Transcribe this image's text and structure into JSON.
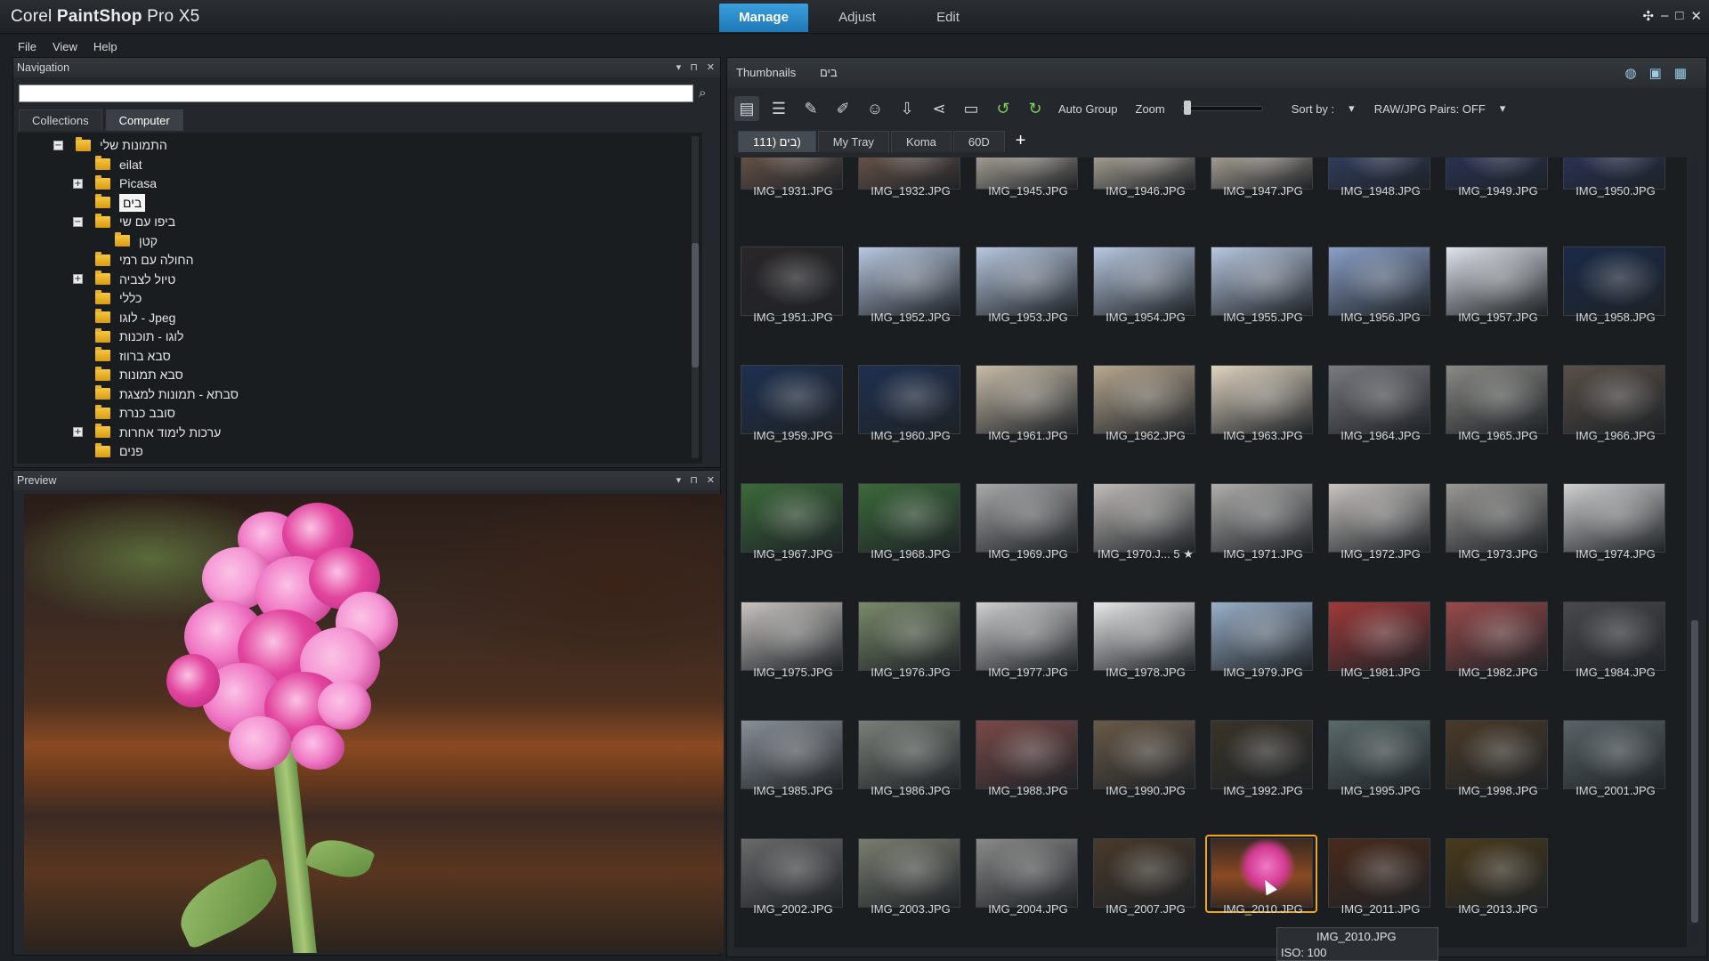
{
  "app": {
    "title_brand": "Corel",
    "title_product": "PaintShop",
    "title_version": "Pro X5",
    "mode_tabs": [
      "Manage",
      "Adjust",
      "Edit"
    ],
    "active_mode": "Manage",
    "window_controls": [
      "✣",
      "–",
      "□",
      "✕"
    ]
  },
  "menu": {
    "items": [
      "File",
      "View",
      "Help"
    ]
  },
  "navigation": {
    "title": "Navigation",
    "search_value": "",
    "tabs": [
      "Collections",
      "Computer"
    ],
    "active_tab": "Computer",
    "tree": [
      {
        "label": "התמונות שלי",
        "indent": 0,
        "expander": "−"
      },
      {
        "label": "eilat",
        "indent": 1,
        "expander": ""
      },
      {
        "label": "Picasa",
        "indent": 1,
        "expander": "+"
      },
      {
        "label": "בים",
        "indent": 1,
        "expander": "",
        "selected": true
      },
      {
        "label": "ביפו עם שי",
        "indent": 1,
        "expander": "−"
      },
      {
        "label": "קטן",
        "indent": 2,
        "expander": ""
      },
      {
        "label": "החולה עם רמי",
        "indent": 1,
        "expander": ""
      },
      {
        "label": "טיול לצביה",
        "indent": 1,
        "expander": "+"
      },
      {
        "label": "כללי",
        "indent": 1,
        "expander": ""
      },
      {
        "label": "לוגו - Jpeg",
        "indent": 1,
        "expander": ""
      },
      {
        "label": "לוגו - תוכנות",
        "indent": 1,
        "expander": ""
      },
      {
        "label": "סבא ברווז",
        "indent": 1,
        "expander": ""
      },
      {
        "label": "סבא תמונות",
        "indent": 1,
        "expander": ""
      },
      {
        "label": "סבתא - תמונות למצגת",
        "indent": 1,
        "expander": ""
      },
      {
        "label": "סובב כנרת",
        "indent": 1,
        "expander": ""
      },
      {
        "label": "ערכות לימוד אחרות",
        "indent": 1,
        "expander": "+"
      },
      {
        "label": "פנים",
        "indent": 1,
        "expander": ""
      }
    ]
  },
  "preview": {
    "title": "Preview"
  },
  "thumbnails": {
    "title": "Thumbnails",
    "folder": "בים",
    "toolbar": {
      "auto_group": "Auto Group",
      "zoom_label": "Zoom",
      "sort_by": "Sort by :",
      "raw_pairs": "RAW/JPG Pairs: OFF"
    },
    "trays": [
      "111) בים)",
      "My Tray",
      "Koma",
      "60D"
    ],
    "active_tray": "111) בים)",
    "add_tray": "+",
    "rows": [
      [
        "IMG_1931.JPG",
        "IMG_1932.JPG",
        "IMG_1945.JPG",
        "IMG_1946.JPG",
        "IMG_1947.JPG",
        "IMG_1948.JPG",
        "IMG_1949.JPG",
        "IMG_1950.JPG"
      ],
      [
        "IMG_1951.JPG",
        "IMG_1952.JPG",
        "IMG_1953.JPG",
        "IMG_1954.JPG",
        "IMG_1955.JPG",
        "IMG_1956.JPG",
        "IMG_1957.JPG",
        "IMG_1958.JPG"
      ],
      [
        "IMG_1959.JPG",
        "IMG_1960.JPG",
        "IMG_1961.JPG",
        "IMG_1962.JPG",
        "IMG_1963.JPG",
        "IMG_1964.JPG",
        "IMG_1965.JPG",
        "IMG_1966.JPG"
      ],
      [
        "IMG_1967.JPG",
        "IMG_1968.JPG",
        "IMG_1969.JPG",
        "IMG_1970.J... 5 ★",
        "IMG_1971.JPG",
        "IMG_1972.JPG",
        "IMG_1973.JPG",
        "IMG_1974.JPG"
      ],
      [
        "IMG_1975.JPG",
        "IMG_1976.JPG",
        "IMG_1977.JPG",
        "IMG_1978.JPG",
        "IMG_1979.JPG",
        "IMG_1981.JPG",
        "IMG_1982.JPG",
        "IMG_1984.JPG"
      ],
      [
        "IMG_1985.JPG",
        "IMG_1986.JPG",
        "IMG_1988.JPG",
        "IMG_1990.JPG",
        "IMG_1992.JPG",
        "IMG_1995.JPG",
        "IMG_1998.JPG",
        "IMG_2001.JPG"
      ],
      [
        "IMG_2002.JPG",
        "IMG_2003.JPG",
        "IMG_2004.JPG",
        "IMG_2007.JPG",
        "IMG_2010.JPG",
        "IMG_2011.JPG",
        "IMG_2013.JPG"
      ]
    ],
    "selected": "IMG_2010.JPG",
    "tooltip": {
      "name": "IMG_2010.JPG",
      "iso": "ISO: 100"
    }
  },
  "colors": {
    "accent": "#1f77b6",
    "selection": "#f3a324"
  }
}
